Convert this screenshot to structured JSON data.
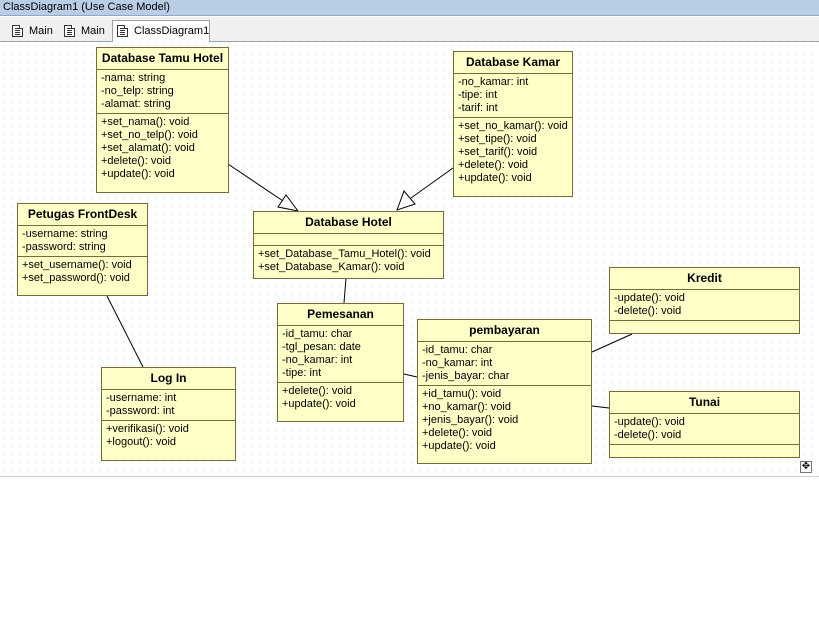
{
  "window": {
    "title": "ClassDiagram1 (Use Case Model)"
  },
  "tabs": [
    {
      "label": "Main"
    },
    {
      "label": "Main"
    },
    {
      "label": "ClassDiagram1"
    }
  ],
  "classes": {
    "tamu": {
      "name": "Database Tamu Hotel",
      "attributes": [
        "-nama: string",
        "-no_telp: string",
        "-alamat: string"
      ],
      "operations": [
        "+set_nama(): void",
        "+set_no_telp(): void",
        "+set_alamat(): void",
        "+delete(): void",
        "+update(): void"
      ]
    },
    "kamar": {
      "name": "Database Kamar",
      "attributes": [
        "-no_kamar: int",
        "-tipe: int",
        "-tarif: int"
      ],
      "operations": [
        "+set_no_kamar(): void",
        "+set_tipe(): void",
        "+set_tarif(): void",
        "+delete(): void",
        "+update(): void"
      ]
    },
    "hotel": {
      "name": "Database Hotel",
      "attributes": [],
      "operations": [
        "+set_Database_Tamu_Hotel(): void",
        "+set_Database_Kamar(): void"
      ]
    },
    "petugas": {
      "name": "Petugas FrontDesk",
      "attributes": [
        "-username: string",
        "-password: string"
      ],
      "operations": [
        "+set_username(): void",
        "+set_password(): void"
      ]
    },
    "login": {
      "name": "Log In",
      "attributes": [
        "-username: int",
        "-password: int"
      ],
      "operations": [
        "+verifikasi(): void",
        "+logout(): void"
      ]
    },
    "pemesanan": {
      "name": "Pemesanan",
      "attributes": [
        "-id_tamu: char",
        "-tgl_pesan: date",
        "-no_kamar: int",
        "-tipe: int"
      ],
      "operations": [
        "+delete(): void",
        "+update(): void"
      ]
    },
    "pembayaran": {
      "name": "pembayaran",
      "attributes": [
        "-id_tamu: char",
        "-no_kamar: int",
        "-jenis_bayar: char"
      ],
      "operations": [
        "+id_tamu(): void",
        "+no_kamar(): void",
        "+jenis_bayar(): void",
        "+delete(): void",
        "+update(): void"
      ]
    },
    "kredit": {
      "name": "Kredit",
      "attributes": [
        "-update(): void",
        "-delete(): void"
      ],
      "operations": []
    },
    "tunai": {
      "name": "Tunai",
      "attributes": [
        "-update(): void",
        "-delete(): void"
      ],
      "operations": []
    }
  }
}
